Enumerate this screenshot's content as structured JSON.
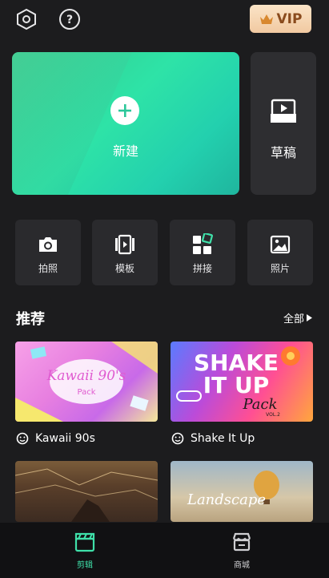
{
  "header": {
    "vip_label": "VIP"
  },
  "main": {
    "new_label": "新建",
    "draft_label": "草稿",
    "tools": [
      {
        "label": "拍照",
        "icon": "camera-icon"
      },
      {
        "label": "模板",
        "icon": "template-icon"
      },
      {
        "label": "拼接",
        "icon": "collage-icon"
      },
      {
        "label": "照片",
        "icon": "photo-icon"
      }
    ]
  },
  "recommend": {
    "title": "推荐",
    "see_all": "全部",
    "items": [
      {
        "name": "Kawaii 90s",
        "thumb_text_1": "Kawaii 90's",
        "thumb_text_2": "Pack"
      },
      {
        "name": "Shake It Up",
        "thumb_text_1": "SHAKE",
        "thumb_text_2": "IT UP",
        "thumb_text_3": "Pack",
        "thumb_text_4": "VOL.2"
      },
      {
        "name": "",
        "thumb_text_1": ""
      },
      {
        "name": "",
        "thumb_text_1": "Landscape"
      }
    ]
  },
  "nav": {
    "edit_label": "剪辑",
    "store_label": "商城"
  },
  "colors": {
    "accent": "#3fe0a9",
    "background": "#1c1c1e",
    "vip_text": "#8a4b1d"
  }
}
